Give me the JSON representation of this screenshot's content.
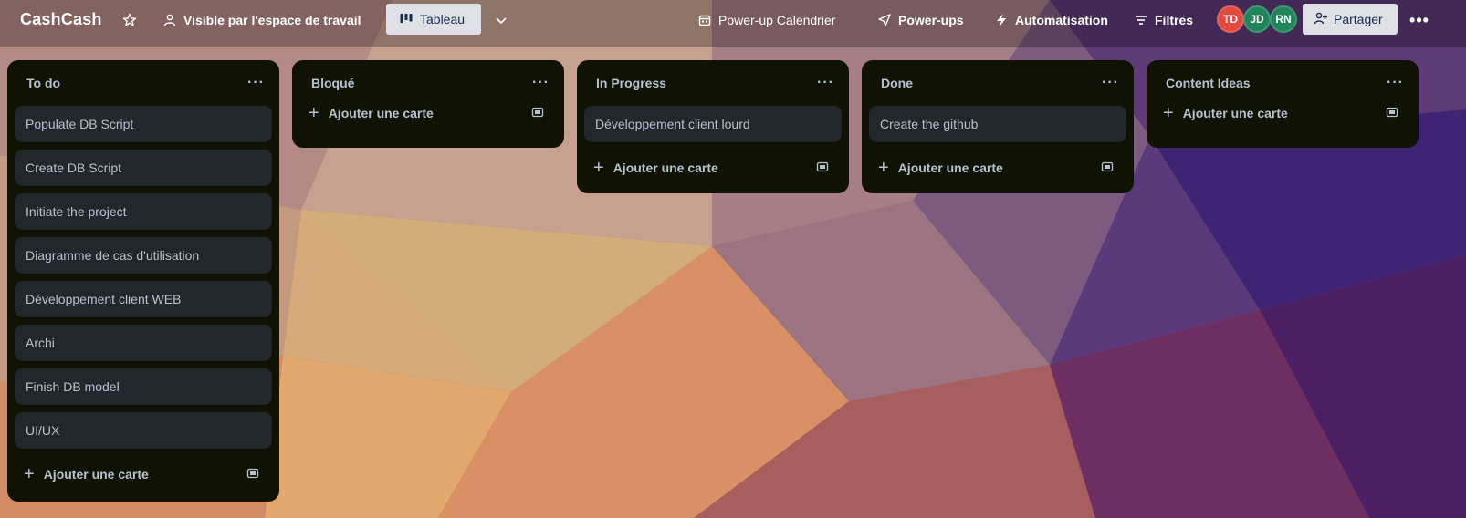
{
  "board": {
    "title": "CashCash",
    "visibility_label": "Visible par l'espace de travail",
    "view_label": "Tableau",
    "calendar_label": "Power-up Calendrier",
    "powerups_label": "Power-ups",
    "automation_label": "Automatisation",
    "filters_label": "Filtres",
    "share_label": "Partager"
  },
  "members": [
    {
      "initials": "TD",
      "color": "#e2483d"
    },
    {
      "initials": "JD",
      "color": "#1f845a"
    },
    {
      "initials": "RN",
      "color": "#1f845a"
    }
  ],
  "add_card_label": "Ajouter une carte",
  "lists": [
    {
      "title": "To do",
      "cards": [
        "Populate DB Script",
        "Create DB Script",
        "Initiate the project",
        "Diagramme de cas d'utilisation",
        "Développement client WEB",
        "Archi",
        "Finish DB model",
        "UI/UX"
      ]
    },
    {
      "title": "Bloqué",
      "cards": []
    },
    {
      "title": "In Progress",
      "cards": [
        "Développement client lourd"
      ]
    },
    {
      "title": "Done",
      "cards": [
        "Create the github"
      ]
    },
    {
      "title": "Content Ideas",
      "cards": []
    }
  ],
  "icons": {
    "star": "star-icon",
    "visibility": "users-icon",
    "view": "board-icon",
    "calendar": "calendar-icon",
    "powerups": "rocket-icon",
    "automation": "bolt-icon",
    "filters": "filter-icon",
    "share": "add-person-icon",
    "template": "template-icon"
  }
}
